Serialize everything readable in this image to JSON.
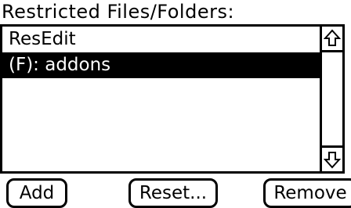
{
  "heading": "Restricted Files/Folders:",
  "list": {
    "items": [
      {
        "label": "ResEdit",
        "selected": false
      },
      {
        "label": "(F): addons",
        "selected": true
      }
    ]
  },
  "scrollbar": {
    "up_icon": "up-arrow-icon",
    "down_icon": "down-arrow-icon"
  },
  "buttons": {
    "add": "Add",
    "reset": "Reset...",
    "remove": "Remove"
  }
}
